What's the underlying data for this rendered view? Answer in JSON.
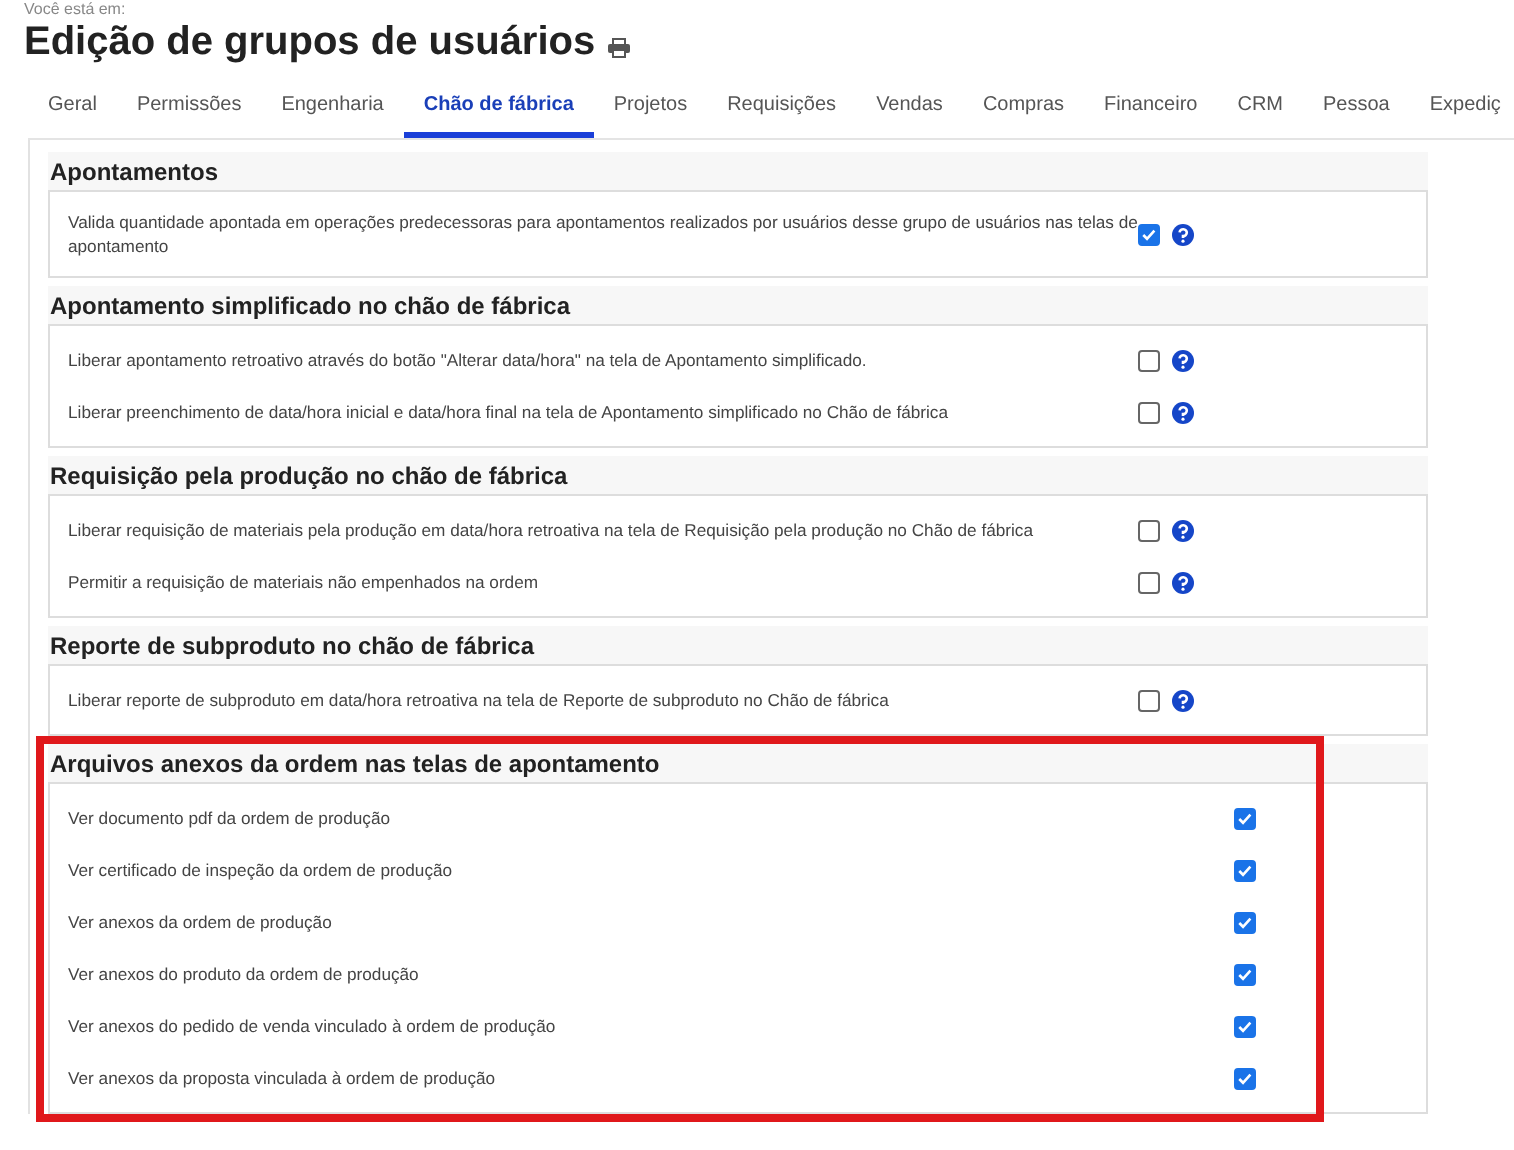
{
  "breadcrumb": "Você está em:",
  "page_title": "Edição de grupos de usuários",
  "tabs": [
    {
      "label": "Geral",
      "selected": false
    },
    {
      "label": "Permissões",
      "selected": false
    },
    {
      "label": "Engenharia",
      "selected": false
    },
    {
      "label": "Chão de fábrica",
      "selected": true
    },
    {
      "label": "Projetos",
      "selected": false
    },
    {
      "label": "Requisições",
      "selected": false
    },
    {
      "label": "Vendas",
      "selected": false
    },
    {
      "label": "Compras",
      "selected": false
    },
    {
      "label": "Financeiro",
      "selected": false
    },
    {
      "label": "CRM",
      "selected": false
    },
    {
      "label": "Pessoa",
      "selected": false
    },
    {
      "label": "Expediç",
      "selected": false
    }
  ],
  "sections": [
    {
      "title": "Apontamentos",
      "highlighted": false,
      "items": [
        {
          "label": "Valida quantidade apontada em operações predecessoras para apontamentos realizados por usuários desse grupo de usuários nas telas de apontamento",
          "checked": true,
          "help": true
        }
      ]
    },
    {
      "title": "Apontamento simplificado no chão de fábrica",
      "highlighted": false,
      "items": [
        {
          "label": "Liberar apontamento retroativo através do botão \"Alterar data/hora\" na tela de Apontamento simplificado.",
          "checked": false,
          "help": true
        },
        {
          "label": "Liberar preenchimento de data/hora inicial e data/hora final na tela de Apontamento simplificado no Chão de fábrica",
          "checked": false,
          "help": true
        }
      ]
    },
    {
      "title": "Requisição pela produção no chão de fábrica",
      "highlighted": false,
      "items": [
        {
          "label": "Liberar requisição de materiais pela produção em data/hora retroativa na tela de Requisição pela produção no Chão de fábrica",
          "checked": false,
          "help": true
        },
        {
          "label": "Permitir a requisição de materiais não empenhados na ordem",
          "checked": false,
          "help": true
        }
      ]
    },
    {
      "title": "Reporte de subproduto no chão de fábrica",
      "highlighted": false,
      "items": [
        {
          "label": "Liberar reporte de subproduto em data/hora retroativa na tela de Reporte de subproduto no Chão de fábrica",
          "checked": false,
          "help": true
        }
      ]
    },
    {
      "title": "Arquivos anexos da ordem nas telas de apontamento",
      "highlighted": true,
      "items": [
        {
          "label": "Ver documento pdf da ordem de produção",
          "checked": true,
          "help": false
        },
        {
          "label": "Ver certificado de inspeção da ordem de produção",
          "checked": true,
          "help": false
        },
        {
          "label": "Ver anexos da ordem de produção",
          "checked": true,
          "help": false
        },
        {
          "label": "Ver anexos do produto da ordem de produção",
          "checked": true,
          "help": false
        },
        {
          "label": "Ver anexos do pedido de venda vinculado à ordem de produção",
          "checked": true,
          "help": false
        },
        {
          "label": "Ver anexos da proposta vinculada à ordem de produção",
          "checked": true,
          "help": false
        }
      ]
    }
  ]
}
